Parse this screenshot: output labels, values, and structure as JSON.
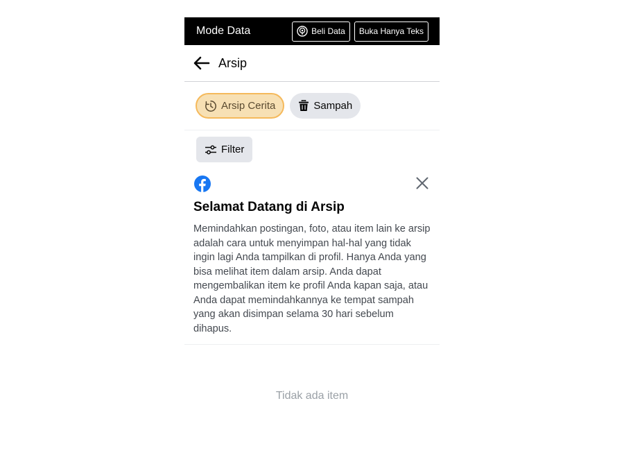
{
  "databar": {
    "title": "Mode Data",
    "buy_label": "Beli Data",
    "text_only_label": "Buka Hanya Teks"
  },
  "header": {
    "title": "Arsip",
    "back_icon": "arrow-left-icon"
  },
  "chips": [
    {
      "label": "Arsip Cerita",
      "icon": "clock-history-icon",
      "active": true
    },
    {
      "label": "Sampah",
      "icon": "trash-icon",
      "active": false
    }
  ],
  "filter": {
    "label": "Filter",
    "icon": "sliders-icon"
  },
  "welcome": {
    "title": "Selamat Datang di Arsip",
    "body": "Memindahkan postingan, foto, atau item lain ke arsip adalah cara untuk menyimpan hal-hal yang tidak ingin lagi Anda tampilkan di profil. Hanya Anda yang bisa melihat item dalam arsip. Anda dapat mengembalikan item ke profil Anda kapan saja, atau Anda dapat memindahkannya ke tempat sampah yang akan disimpan selama 30 hari sebelum dihapus."
  },
  "empty_state": "Tidak ada item",
  "colors": {
    "brand": "#1877f2",
    "active_chip_bg": "#f7e0b4",
    "active_chip_border": "#f5b95b"
  }
}
